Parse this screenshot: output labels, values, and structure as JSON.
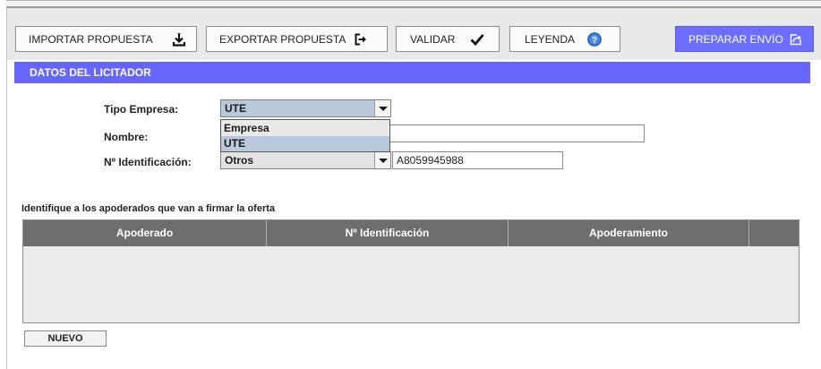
{
  "toolbar": {
    "import_label": "IMPORTAR PROPUESTA",
    "export_label": "EXPORTAR PROPUESTA",
    "validate_label": "VALIDAR",
    "legend_label": "LEYENDA",
    "send_label": "PREPARAR ENVÍO"
  },
  "section": {
    "title": "DATOS DEL LICITADOR"
  },
  "form": {
    "tipo_empresa_label": "Tipo Empresa:",
    "tipo_empresa_value": "UTE",
    "tipo_empresa_options": [
      "Empresa",
      "UTE"
    ],
    "nombre_label": "Nombre:",
    "nombre_value": "",
    "id_label": "Nº Identificación:",
    "id_type_value": "Otros",
    "id_number_value": "A8059945988"
  },
  "apoderados": {
    "caption": "Identifique a los apoderados que van a firmar la oferta",
    "columns": [
      "Apoderado",
      "Nº Identificación",
      "Apoderamiento",
      ""
    ],
    "rows": [],
    "new_button_label": "NUEVO"
  },
  "colors": {
    "accent": "#6666ff",
    "selection": "#b8c9dc",
    "table_header": "#6e6e6e"
  },
  "icons": {
    "import": "download-icon",
    "export": "export-icon",
    "validate": "checkmark-icon",
    "legend": "help-icon",
    "send": "send-icon"
  }
}
